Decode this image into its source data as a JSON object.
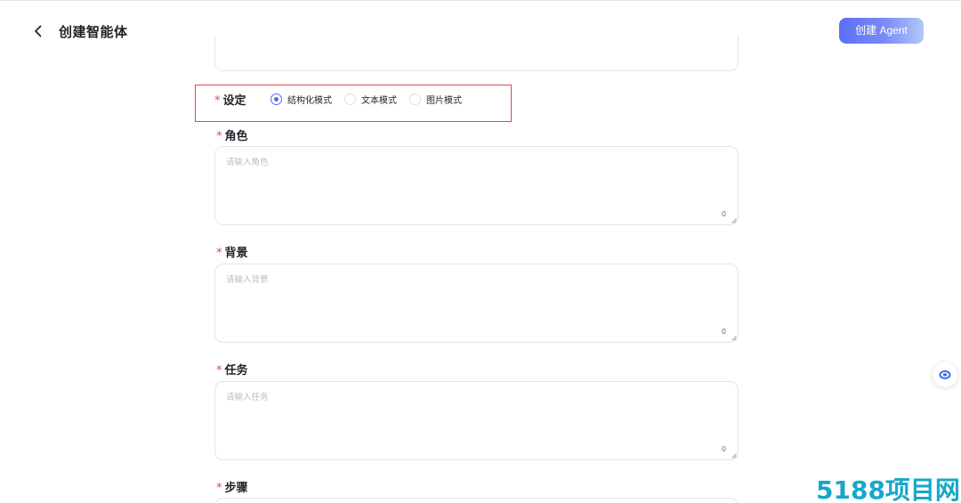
{
  "header": {
    "title": "创建智能体",
    "create_button": "创建 Agent",
    "back_icon": "chevron-left-icon"
  },
  "setting": {
    "required_mark": "*",
    "label": "设定",
    "options": [
      {
        "label": "结构化模式",
        "selected": true
      },
      {
        "label": "文本模式",
        "selected": false
      },
      {
        "label": "图片模式",
        "selected": false
      }
    ]
  },
  "fields": [
    {
      "label": "角色",
      "placeholder": "请输入角色",
      "count": "0"
    },
    {
      "label": "背景",
      "placeholder": "请输入背景",
      "count": "0"
    },
    {
      "label": "任务",
      "placeholder": "请输入任务",
      "count": "0"
    },
    {
      "label": "步骤"
    }
  ],
  "colors": {
    "accent": "#4e6ef2",
    "required": "#e5474a",
    "highlight_border": "#e5474a",
    "watermark": "#16a8c9"
  },
  "float_button": {
    "icon": "assistant-icon"
  },
  "watermark": {
    "text": "5188项目网"
  }
}
